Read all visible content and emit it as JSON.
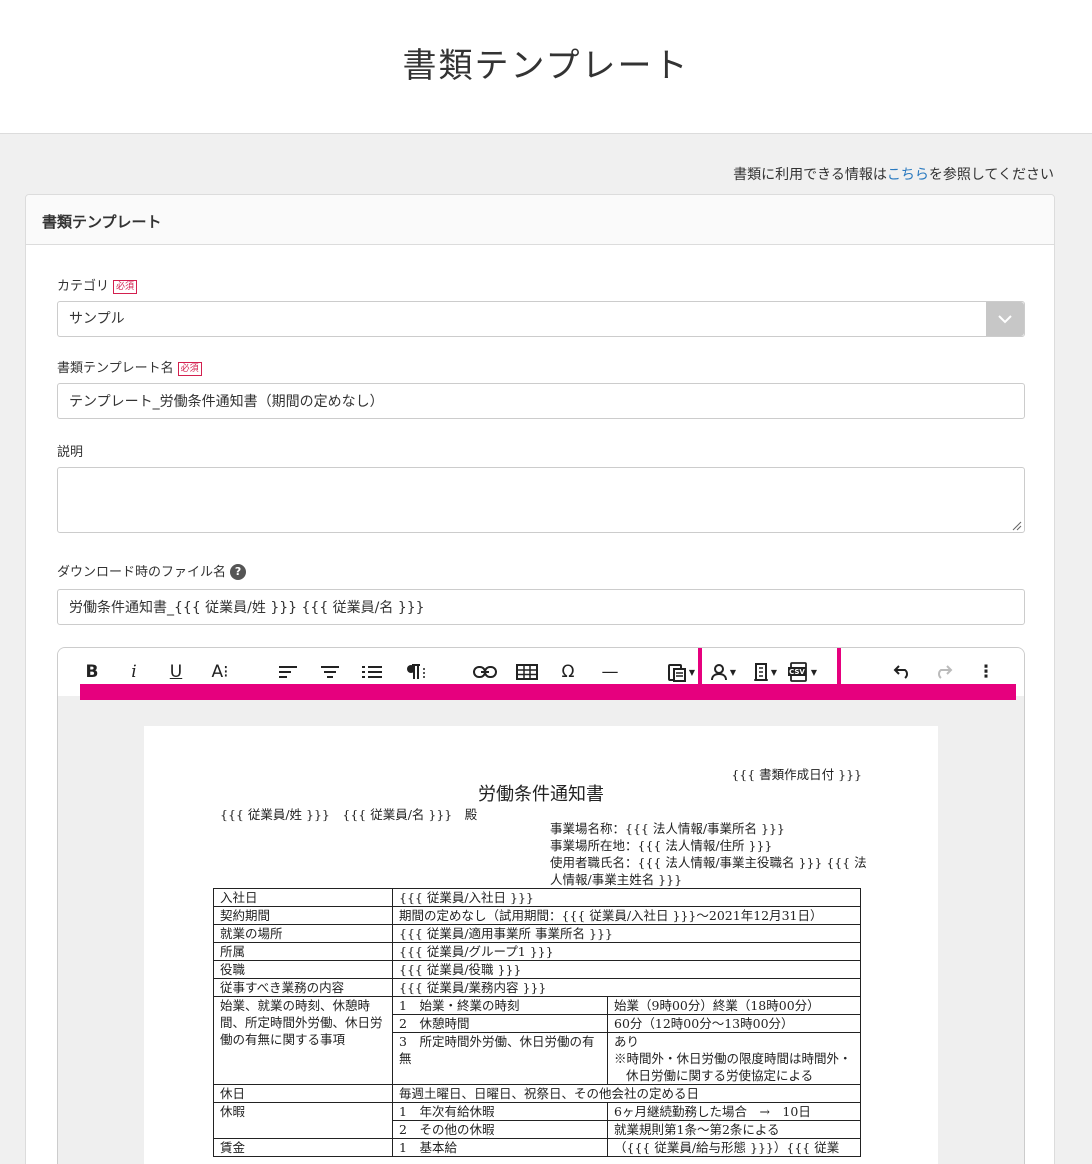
{
  "header": {
    "title": "書類テンプレート"
  },
  "help": {
    "prefix": "書類に利用できる情報は",
    "link": "こちら",
    "suffix": "を参照してください"
  },
  "card": {
    "title": "書類テンプレート"
  },
  "form": {
    "category": {
      "label": "カテゴリ",
      "required": "必須",
      "value": "サンプル"
    },
    "template_name": {
      "label": "書類テンプレート名",
      "required": "必須",
      "value": "テンプレート_労働条件通知書（期間の定めなし）"
    },
    "description": {
      "label": "説明",
      "value": ""
    },
    "filename": {
      "label": "ダウンロード時のファイル名",
      "help_icon": "question-circle-icon",
      "value": "労働条件通知書_{{{ 従業員/姓 }}} {{{ 従業員/名 }}}"
    }
  },
  "toolbar": {
    "bold": "B",
    "italic": "i",
    "underline": "U",
    "font_size": "A⁝",
    "omega": "Ω",
    "hr": "—",
    "more": "⋮",
    "icons": [
      "bold-icon",
      "italic-icon",
      "underline-icon",
      "font-size-icon",
      "align-left-icon",
      "align-center-icon",
      "ordered-list-icon",
      "paragraph-format-icon",
      "link-icon",
      "table-icon",
      "special-char-icon",
      "horizontal-line-icon",
      "paste-icon",
      "user-fields-icon",
      "company-fields-icon",
      "csv-fields-icon",
      "undo-icon",
      "redo-icon",
      "more-icon"
    ],
    "highlight_color": "#e6007e"
  },
  "document": {
    "date": "{{{ 書類作成日付 }}}",
    "title": "労働条件通知書",
    "addressee": "{{{ 従業員/姓 }}}　{{{ 従業員/名 }}}　殿",
    "employer": {
      "line1": "事業場名称：{{{ 法人情報/事業所名 }}}",
      "line2": "事業場所在地：{{{ 法人情報/住所 }}}",
      "line3": "使用者職氏名：{{{ 法人情報/事業主役職名 }}} {{{ 法人情報/事業主姓名 }}}"
    },
    "rows": {
      "r1": {
        "k": "入社日",
        "v": "{{{ 従業員/入社日 }}}"
      },
      "r2": {
        "k": "契約期間",
        "v": "期間の定めなし（試用期間：{{{ 従業員/入社日 }}}～2021年12月31日）"
      },
      "r3": {
        "k": "就業の場所",
        "v": "{{{ 従業員/適用事業所 事業所名 }}}"
      },
      "r4": {
        "k": "所属",
        "v": "{{{ 従業員/グループ1 }}}"
      },
      "r5": {
        "k": "役職",
        "v": "{{{ 従業員/役職 }}}"
      },
      "r6": {
        "k": "従事すべき業務の内容",
        "v": "{{{ 従業員/業務内容 }}}"
      },
      "r7": {
        "k": "始業、就業の時刻、休憩時間、所定時間外労働、休日労働の有無に関する事項",
        "a1": "1　始業・終業の時刻",
        "b1": "始業（9時00分）終業（18時00分）",
        "a2": "2　休憩時間",
        "b2": "60分（12時00分～13時00分）",
        "a3": "3　所定時間外労働、休日労働の有無",
        "b3": "あり",
        "b3_note": "※時間外・休日労働の限度時間は時間外・休日労働に関する労使協定による"
      },
      "r8": {
        "k": "休日",
        "v": "毎週土曜日、日曜日、祝祭日、その他会社の定める日"
      },
      "r9": {
        "k": "休暇",
        "a1": "1　年次有給休暇",
        "b1": "6ヶ月継続勤務した場合　→　10日",
        "a2": "2　その他の休暇",
        "b2": "就業規則第1条～第2条による"
      },
      "r10": {
        "k": "賃金",
        "a1": "1　基本給",
        "b1": "（{{{ 従業員/給与形態 }}}）{{{ 従業"
      }
    }
  }
}
